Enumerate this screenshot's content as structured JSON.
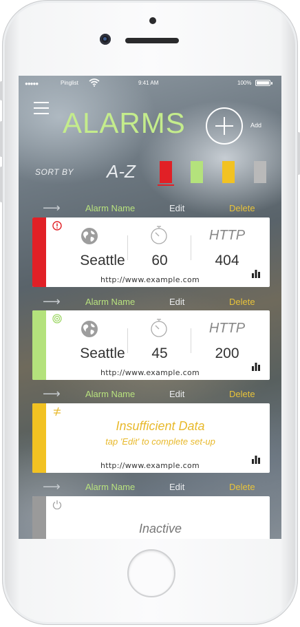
{
  "status_bar": {
    "signal": "●●●●●",
    "carrier": "Pinglist",
    "time": "9:41 AM",
    "battery": "100%"
  },
  "header": {
    "title": "ALARMS",
    "add_label": "Add"
  },
  "sort": {
    "label": "SORT BY",
    "az": "A-Z",
    "swatches": [
      {
        "color": "#e12026",
        "selected": true
      },
      {
        "color": "#b4e27c",
        "selected": false
      },
      {
        "color": "#f2c222",
        "selected": false
      },
      {
        "color": "#b9b9b9",
        "selected": false
      }
    ]
  },
  "row_header": {
    "arrow": "⟶",
    "name": "Alarm Name",
    "edit": "Edit",
    "delete": "Delete"
  },
  "alarms": [
    {
      "status": "critical",
      "stripe_color": "#e12026",
      "status_icon": "alert-icon",
      "city": "Seattle",
      "interval": "60",
      "protocol": "HTTP",
      "code": "404",
      "url": "http://www.example.com"
    },
    {
      "status": "ok",
      "stripe_color": "#b4e27c",
      "status_icon": "target-icon",
      "city": "Seattle",
      "interval": "45",
      "protocol": "HTTP",
      "code": "200",
      "url": "http://www.example.com"
    },
    {
      "status": "insufficient",
      "stripe_color": "#f2c222",
      "status_icon": "not-equal-icon",
      "title": "Insufficient Data",
      "subtitle": "tap 'Edit' to complete set-up",
      "url": "http://www.example.com"
    },
    {
      "status": "inactive",
      "stripe_color": "#9a9a9a",
      "status_icon": "power-icon",
      "title": "Inactive"
    }
  ]
}
